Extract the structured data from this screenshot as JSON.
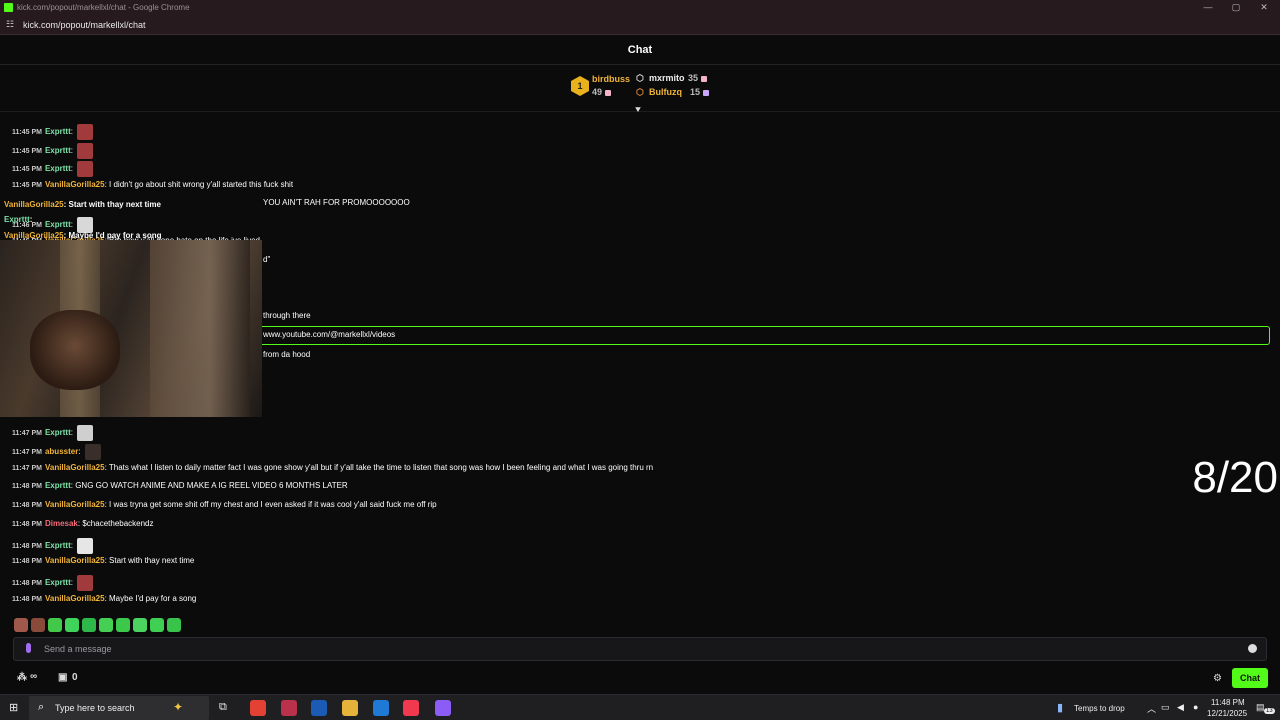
{
  "window": {
    "title": "kick.com/popout/markellxl/chat - Google Chrome",
    "url": "kick.com/popout/markellxl/chat"
  },
  "chat": {
    "header": "Chat",
    "leaderboard": {
      "first": {
        "rank": "1",
        "name": "birdbuss",
        "count": "49"
      },
      "second": {
        "name": "mxrmito",
        "count": "35"
      },
      "third": {
        "name": "Bulfuzq",
        "count": "15"
      }
    },
    "messages": [
      {
        "time": "11:45 PM",
        "user": "Exprttt",
        "text": "",
        "color": "#7ee2a8",
        "emote": "#a13b3b"
      },
      {
        "time": "11:45 PM",
        "user": "Exprttt",
        "text": "",
        "color": "#7ee2a8",
        "emote": "#a13b3b"
      },
      {
        "time": "11:45 PM",
        "user": "Exprttt",
        "text": "",
        "color": "#7ee2a8",
        "emote": "#a13b3b"
      },
      {
        "time": "11:45 PM",
        "user": "VanillaGorilla25",
        "text": "I didn't go about shit wrong y'all started this fuck shit",
        "color": "#f0b43a"
      },
      {
        "time": "",
        "user": "",
        "text": "YOU AIN'T RAH FOR PROMOOOOOOO",
        "color": "#fff"
      },
      {
        "time": "11:46 PM",
        "user": "Exprttt",
        "text": "",
        "color": "#7ee2a8",
        "emote": "#d8d8d8"
      },
      {
        "time": "11:46 PM",
        "user": "VanillaGorilla25",
        "text": "Bro how y'all gone hate on the life ive lived",
        "color": "#f0b43a"
      },
      {
        "time": "",
        "user": "",
        "text": "d\"",
        "color": "#fff"
      },
      {
        "time": "",
        "user": "",
        "text": "through there",
        "color": "#fff"
      },
      {
        "time": "",
        "user": "",
        "text": "www.youtube.com/@markellxl/videos",
        "color": "#fff"
      },
      {
        "time": "",
        "user": "",
        "text": "from da hood",
        "color": "#fff"
      },
      {
        "time": "11:47 PM",
        "user": "Exprttt",
        "text": "",
        "color": "#7ee2a8",
        "emote": "#cfcfcf"
      },
      {
        "time": "11:47 PM",
        "user": "abusster",
        "text": "",
        "color": "#f0b43a",
        "emote": "#3a2e2a"
      },
      {
        "time": "11:47 PM",
        "user": "VanillaGorilla25",
        "text": "Thats what I listen to daily matter fact I was gone show y'all but if y'all take the time to listen that song was how I been feeling and what I was going thru rn",
        "color": "#f0b43a"
      },
      {
        "time": "11:48 PM",
        "user": "Exprttt",
        "text": "GNG GO WATCH ANIME AND MAKE A IG REEL VIDEO 6 MONTHS LATER",
        "color": "#7ee2a8"
      },
      {
        "time": "11:48 PM",
        "user": "VanillaGorilla25",
        "text": "I was tryna get some shit off my chest and I even asked if it was cool y'all said fuck me off rip",
        "color": "#f0b43a"
      },
      {
        "time": "11:48 PM",
        "user": "Dimesak",
        "text": "$chacethebackendz",
        "color": "#f26b7a"
      },
      {
        "time": "11:48 PM",
        "user": "Exprttt",
        "text": "",
        "color": "#7ee2a8",
        "emote": "#e6e6e6"
      },
      {
        "time": "11:48 PM",
        "user": "VanillaGorilla25",
        "text": "Start with thay next time",
        "color": "#f0b43a"
      },
      {
        "time": "11:48 PM",
        "user": "Exprttt",
        "text": "",
        "color": "#7ee2a8",
        "emote": "#a13b3b"
      },
      {
        "time": "11:48 PM",
        "user": "VanillaGorilla25",
        "text": "Maybe I'd pay for a song",
        "color": "#f0b43a"
      }
    ],
    "overlay": [
      {
        "user": "VanillaGorilla25",
        "text": ": Start with thay next time"
      },
      {
        "user": "Exprttt",
        "text": ":"
      },
      {
        "user": "VanillaGorilla25",
        "text": ": Maybe I'd pay for a song"
      }
    ],
    "counter": "8/20",
    "input_placeholder": "Send a message",
    "viewers_label": "∞",
    "gift_count": "0",
    "chat_button": "Chat"
  },
  "taskbar": {
    "search_placeholder": "Type here to search",
    "weather": "Temps to drop",
    "time": "11:48 PM",
    "date": "12/21/2025",
    "notif_count": "13"
  },
  "colors": {
    "accent": "#53fc18",
    "background": "#0b0b0c"
  }
}
